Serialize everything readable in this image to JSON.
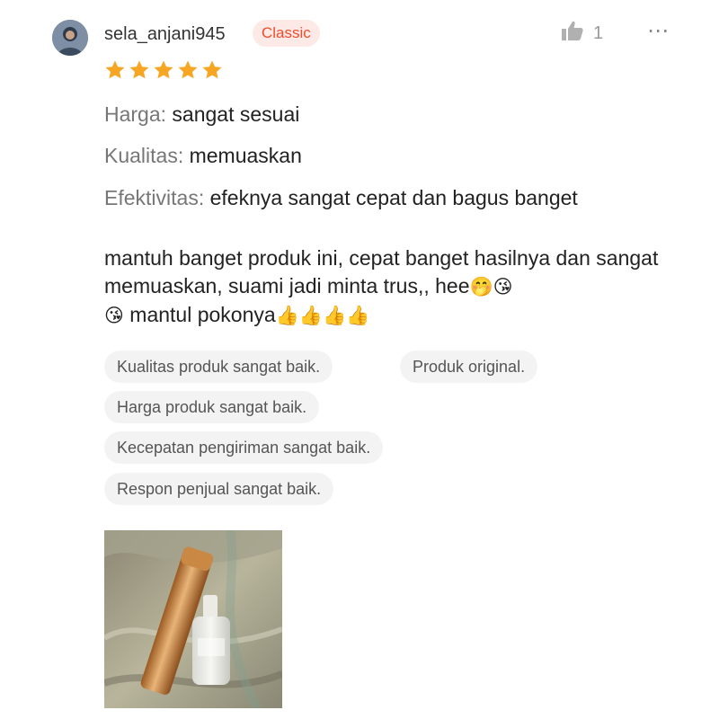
{
  "review": {
    "username": "sela_anjani945",
    "badge": "Classic",
    "likes": "1",
    "more": "⋯",
    "rating": 5,
    "rating_max": 5,
    "attributes": [
      {
        "key": "Harga:",
        "value": " sangat sesuai"
      },
      {
        "key": "Kualitas:",
        "value": " memuaskan"
      },
      {
        "key": "Efektivitas:",
        "value": " efeknya sangat cepat dan bagus banget"
      }
    ],
    "comment_text": "mantuh banget produk ini, cepat banget hasilnya dan sangat memuaskan, suami jadi minta trus,, hee",
    "comment_emoji_1": "🤭😘",
    "comment_emoji_2": "😘",
    "comment_text_2": " mantul pokonya",
    "comment_emoji_3": "👍👍👍👍",
    "tags": [
      "Kualitas produk sangat baik.",
      "Produk original.",
      "Harga produk sangat baik.",
      "Kecepatan pengiriman sangat baik.",
      "Respon penjual sangat baik."
    ]
  },
  "colors": {
    "star": "#f6a623",
    "badge_text": "#ee4d2d",
    "badge_bg": "#fde9e6",
    "tag_bg": "#f3f3f3"
  },
  "icons": {
    "like": "thumbs-up-icon",
    "more": "more-dots-icon",
    "star": "star-icon"
  }
}
